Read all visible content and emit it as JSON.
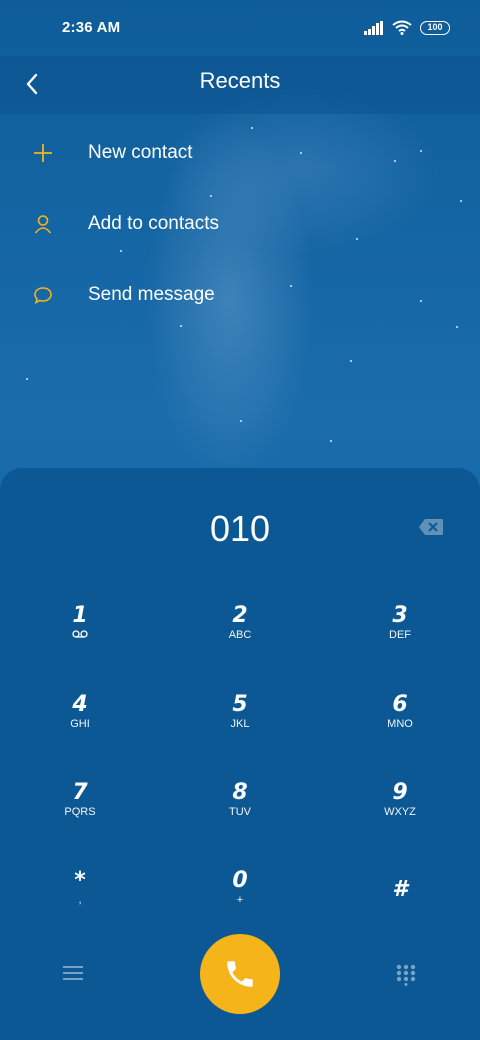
{
  "status": {
    "time": "2:36 AM",
    "battery": "100"
  },
  "header": {
    "title": "Recents"
  },
  "actions": [
    {
      "label": "New contact",
      "icon": "plus-icon"
    },
    {
      "label": "Add to contacts",
      "icon": "person-icon"
    },
    {
      "label": "Send message",
      "icon": "chat-bubble-icon"
    }
  ],
  "dialer": {
    "number": "010",
    "keys": [
      {
        "digit": "1",
        "sub": ""
      },
      {
        "digit": "2",
        "sub": "ABC"
      },
      {
        "digit": "3",
        "sub": "DEF"
      },
      {
        "digit": "4",
        "sub": "GHI"
      },
      {
        "digit": "5",
        "sub": "JKL"
      },
      {
        "digit": "6",
        "sub": "MNO"
      },
      {
        "digit": "7",
        "sub": "PQRS"
      },
      {
        "digit": "8",
        "sub": "TUV"
      },
      {
        "digit": "9",
        "sub": "WXYZ"
      },
      {
        "digit": "*",
        "sub": ","
      },
      {
        "digit": "0",
        "sub": "+"
      },
      {
        "digit": "#",
        "sub": ""
      }
    ]
  },
  "colors": {
    "accent": "#f6b41b",
    "background": "#0c5894"
  }
}
